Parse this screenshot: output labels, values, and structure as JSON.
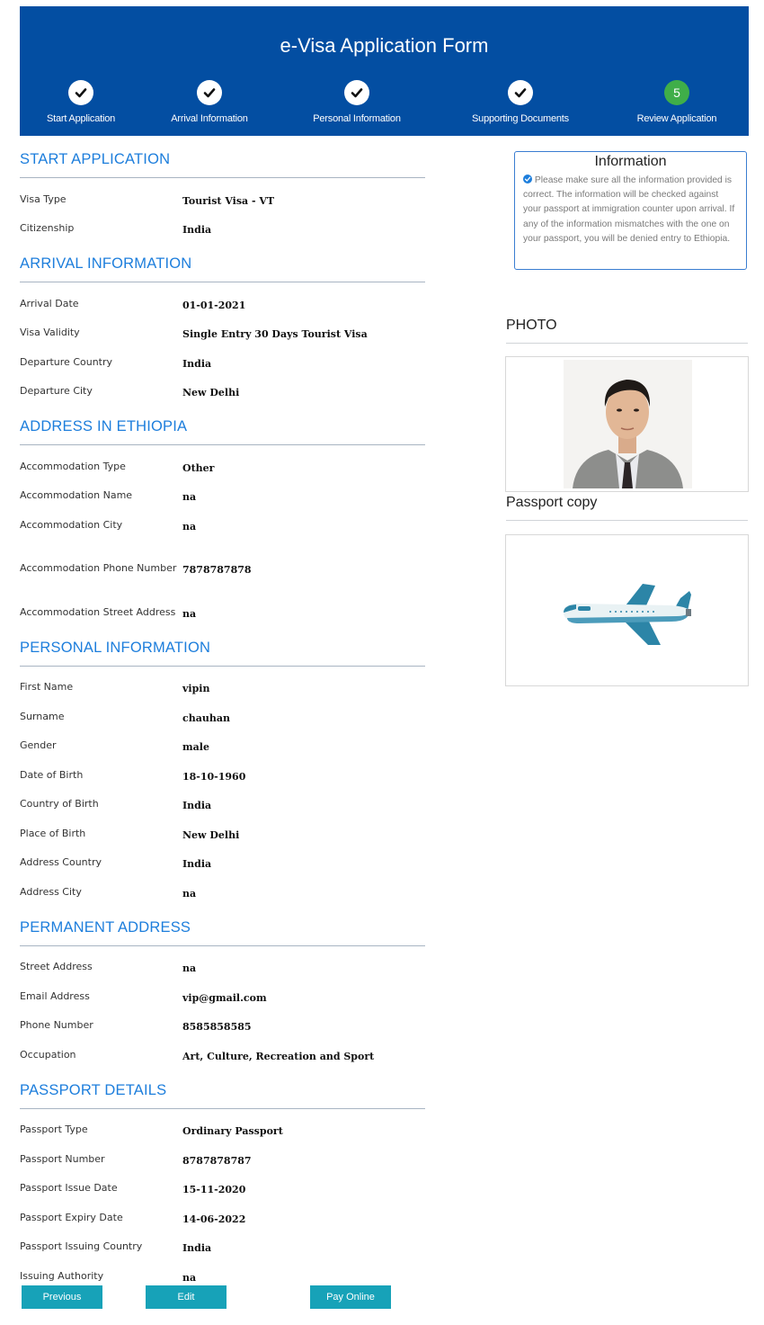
{
  "header": {
    "title": "e-Visa Application Form",
    "steps": [
      {
        "label": "Start Application",
        "state": "done"
      },
      {
        "label": "Arrival Information",
        "state": "done"
      },
      {
        "label": "Personal Information",
        "state": "done"
      },
      {
        "label": "Supporting Documents",
        "state": "done"
      },
      {
        "label": "Review Application",
        "state": "active",
        "number": "5"
      }
    ],
    "colors": {
      "bar": "#034ea2",
      "active": "#3fae49"
    }
  },
  "sections": {
    "start": {
      "title": "START APPLICATION",
      "rows": [
        {
          "label": "Visa Type",
          "value": "Tourist Visa - VT"
        },
        {
          "label": "Citizenship",
          "value": "India"
        }
      ]
    },
    "arrival": {
      "title": "ARRIVAL INFORMATION",
      "rows": [
        {
          "label": "Arrival Date",
          "value": "01-01-2021"
        },
        {
          "label": "Visa Validity",
          "value": "Single Entry 30 Days Tourist Visa"
        },
        {
          "label": "Departure Country",
          "value": "India"
        },
        {
          "label": "Departure City",
          "value": "New Delhi"
        }
      ]
    },
    "address": {
      "title": "ADDRESS IN ETHIOPIA",
      "rows": [
        {
          "label": "Accommodation Type",
          "value": "Other"
        },
        {
          "label": "Accommodation Name",
          "value": "na"
        },
        {
          "label": "Accommodation City",
          "value": "na"
        },
        {
          "label": "Accommodation Phone Number",
          "value": "7878787878"
        },
        {
          "label": "Accommodation Street Address",
          "value": "na"
        }
      ]
    },
    "personal": {
      "title": "PERSONAL INFORMATION",
      "rows": [
        {
          "label": "First Name",
          "value": "vipin"
        },
        {
          "label": "Surname",
          "value": "chauhan"
        },
        {
          "label": "Gender",
          "value": "male"
        },
        {
          "label": "Date of Birth",
          "value": "18-10-1960"
        },
        {
          "label": "Country of Birth",
          "value": "India"
        },
        {
          "label": "Place of Birth",
          "value": "New Delhi"
        },
        {
          "label": "Address Country",
          "value": "India"
        },
        {
          "label": "Address City",
          "value": "na"
        }
      ]
    },
    "permanent": {
      "title": "PERMANENT ADDRESS",
      "rows": [
        {
          "label": "Street Address",
          "value": "na"
        },
        {
          "label": "Email Address",
          "value": "vip@gmail.com"
        },
        {
          "label": "Phone Number",
          "value": "8585858585"
        },
        {
          "label": "Occupation",
          "value": "Art, Culture, Recreation and Sport"
        }
      ]
    },
    "passport": {
      "title": "PASSPORT DETAILS",
      "rows": [
        {
          "label": "Passport Type",
          "value": "Ordinary Passport"
        },
        {
          "label": "Passport Number",
          "value": "8787878787"
        },
        {
          "label": "Passport Issue Date",
          "value": "15-11-2020"
        },
        {
          "label": "Passport Expiry Date",
          "value": "14-06-2022"
        },
        {
          "label": "Passport Issuing Country",
          "value": "India"
        },
        {
          "label": "Issuing Authority",
          "value": "na"
        }
      ]
    }
  },
  "info": {
    "title": "Information",
    "icon": "check-circle-icon",
    "text": "Please make sure all the information provided is correct. The information will be checked against your passport at immigration counter upon arrival. If any of the information mismatches with the one on your passport, you will be denied entry to Ethiopia."
  },
  "photo": {
    "heading": "PHOTO"
  },
  "passport_copy": {
    "heading": "Passport copy",
    "icon": "airplane-icon"
  },
  "buttons": {
    "previous": "Previous",
    "edit": "Edit",
    "pay": "Pay Online",
    "color": "#17a2b8"
  }
}
